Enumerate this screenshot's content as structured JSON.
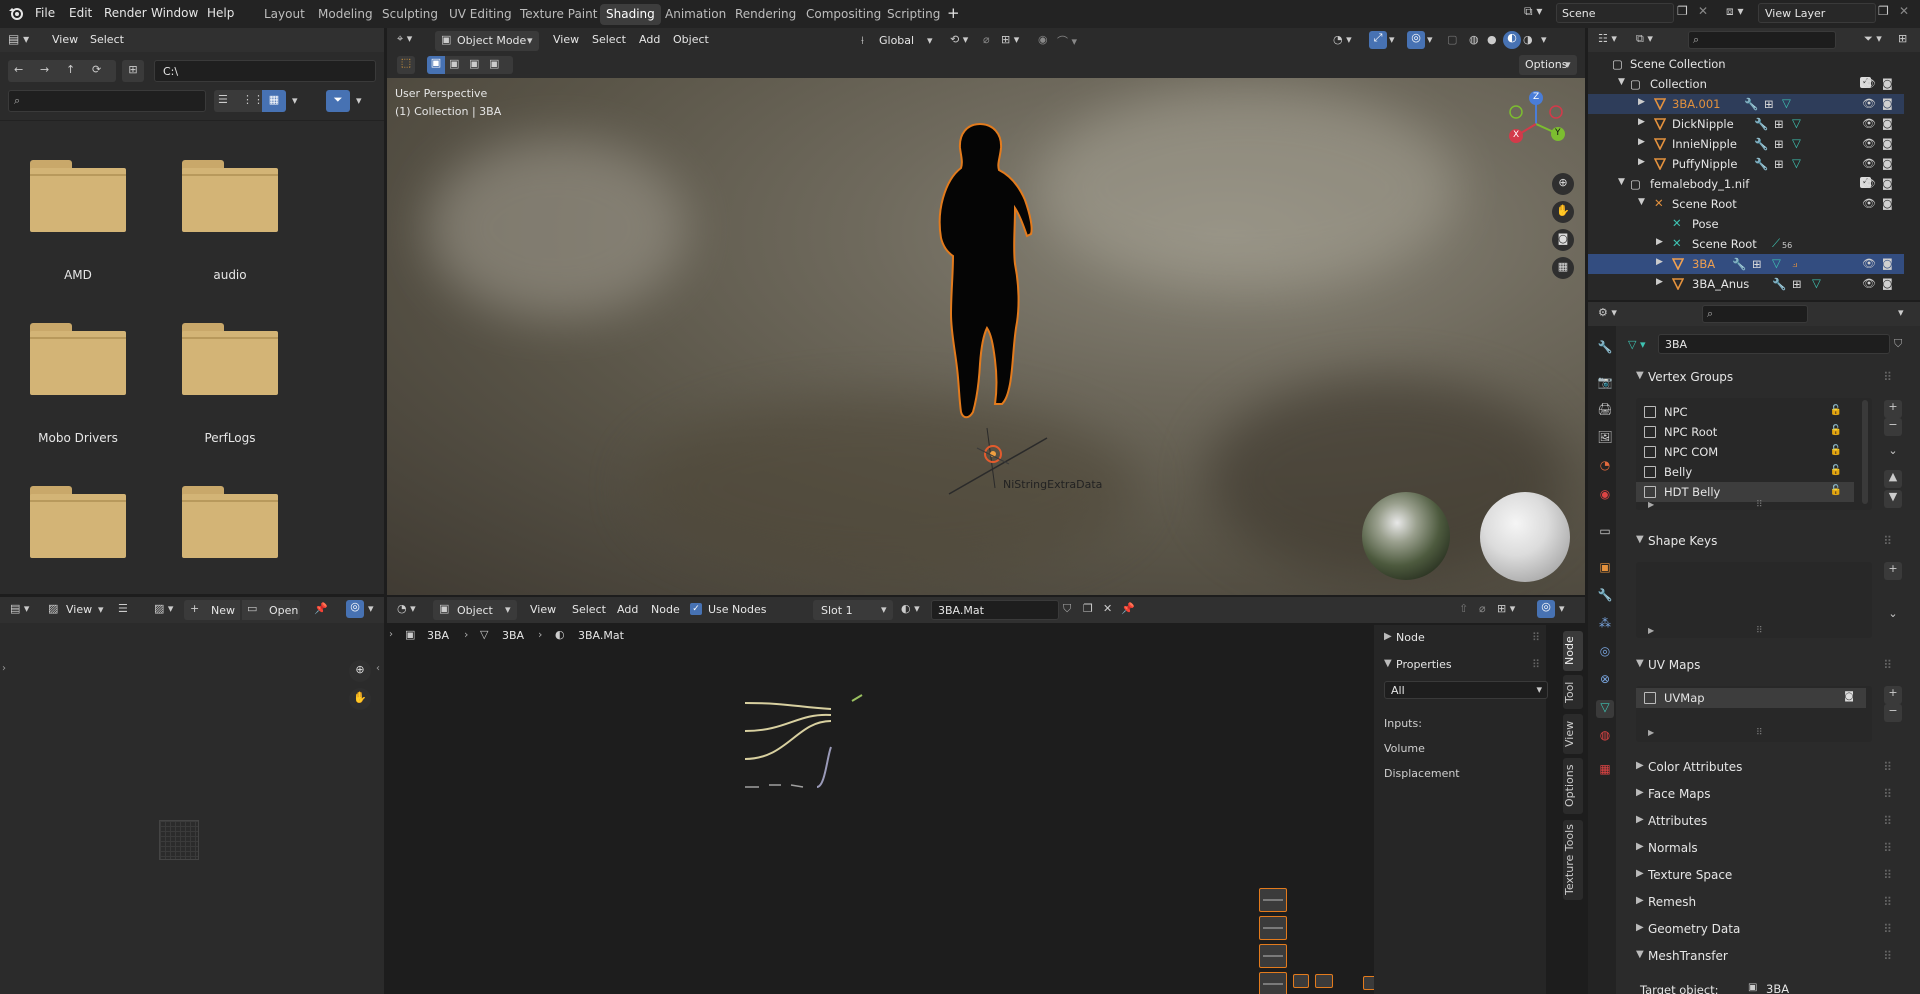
{
  "topbar": {
    "menus": [
      "File",
      "Edit",
      "Render",
      "Window",
      "Help"
    ],
    "workspaces": [
      "Layout",
      "Modeling",
      "Sculpting",
      "UV Editing",
      "Texture Paint",
      "Shading",
      "Animation",
      "Rendering",
      "Compositing",
      "Scripting"
    ],
    "active_workspace": "Shading",
    "add_tab": "+",
    "scene": "Scene",
    "view_layer": "View Layer"
  },
  "file_browser": {
    "menus": [
      "View",
      "Select"
    ],
    "path": "C:\\",
    "search_placeholder": "",
    "folders": [
      "AMD",
      "audio",
      "Mobo Drivers",
      "PerfLogs",
      "",
      ""
    ]
  },
  "viewport": {
    "mode": "Object Mode",
    "menus": [
      "View",
      "Select",
      "Add",
      "Object"
    ],
    "orientation": "Global",
    "options": "Options",
    "perspective": "User Perspective",
    "collection_label": "(1) Collection | 3BA",
    "object_text": "NiStringExtraData",
    "gizmo": {
      "z": "Z",
      "y": "Y",
      "x": "X"
    }
  },
  "outliner": {
    "search_placeholder": "",
    "rows": [
      {
        "label": "Scene Collection",
        "indent": 0,
        "kind": "collection"
      },
      {
        "label": "Collection",
        "indent": 1,
        "kind": "collection"
      },
      {
        "label": "3BA.001",
        "indent": 2,
        "kind": "mesh",
        "highlight": true
      },
      {
        "label": "DickNipple",
        "indent": 2,
        "kind": "mesh"
      },
      {
        "label": "InnieNipple",
        "indent": 2,
        "kind": "mesh"
      },
      {
        "label": "PuffyNipple",
        "indent": 2,
        "kind": "mesh"
      },
      {
        "label": "femalebody_1.nif",
        "indent": 1,
        "kind": "collection"
      },
      {
        "label": "Scene Root",
        "indent": 2,
        "kind": "armature"
      },
      {
        "label": "Pose",
        "indent": 3,
        "kind": "pose"
      },
      {
        "label": "Scene Root",
        "indent": 3,
        "kind": "armature",
        "badge": "56"
      },
      {
        "label": "3BA",
        "indent": 3,
        "kind": "mesh",
        "selected": true
      },
      {
        "label": "3BA_Anus",
        "indent": 3,
        "kind": "mesh"
      }
    ]
  },
  "properties": {
    "object_name": "3BA",
    "vertex_groups_title": "Vertex Groups",
    "vertex_groups": [
      "NPC",
      "NPC Root",
      "NPC COM",
      "Belly",
      "HDT Belly"
    ],
    "shape_keys_title": "Shape Keys",
    "uv_maps_title": "UV Maps",
    "uv_map": "UVMap",
    "sections": [
      "Color Attributes",
      "Face Maps",
      "Attributes",
      "Normals",
      "Texture Space",
      "Remesh",
      "Geometry Data"
    ],
    "meshtransfer_title": "MeshTransfer",
    "target_label": "Target object:",
    "target_value": "3BA"
  },
  "image_editor": {
    "view": "View",
    "new": "New",
    "open": "Open"
  },
  "node_editor": {
    "type": "Object",
    "menus": [
      "View",
      "Select",
      "Add",
      "Node"
    ],
    "use_nodes": "Use Nodes",
    "slot": "Slot 1",
    "material": "3BA.Mat",
    "breadcrumb": [
      "3BA",
      "3BA",
      "3BA.Mat"
    ],
    "sidebar": {
      "node": "Node",
      "properties": "Properties",
      "filter": "All",
      "inputs": "Inputs:",
      "items": [
        "Volume",
        "Displacement"
      ],
      "tabs": [
        "Node",
        "Tool",
        "View",
        "Options",
        "Texture Tools"
      ]
    }
  },
  "colors": {
    "accent_blue": "#4772b3",
    "selection_orange": "#e37b1d",
    "folder": "#d3b476"
  }
}
